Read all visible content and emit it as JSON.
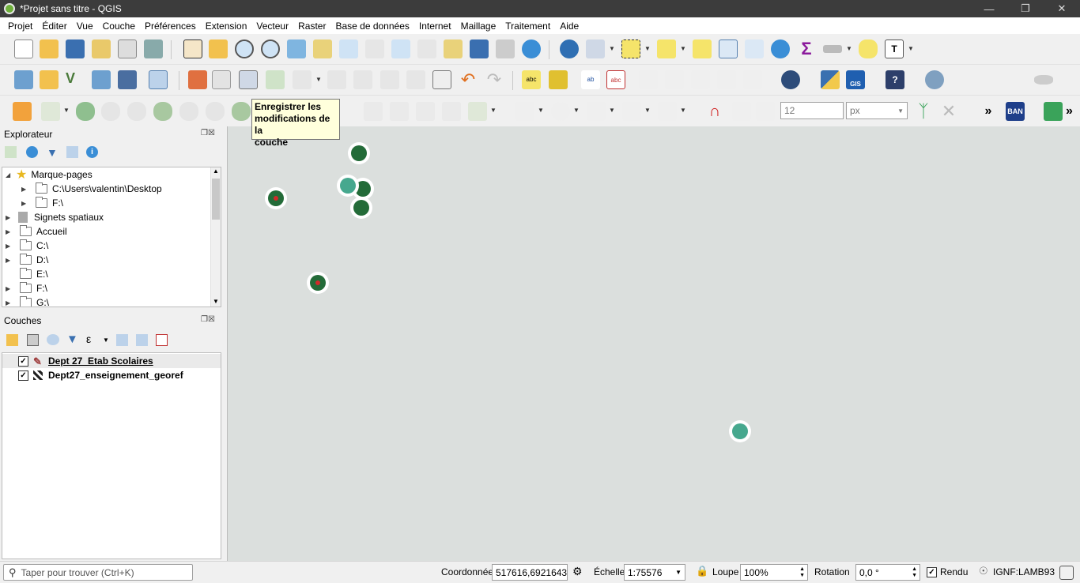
{
  "window": {
    "title": "*Projet sans titre - QGIS"
  },
  "menu": [
    "Projet",
    "Éditer",
    "Vue",
    "Couche",
    "Préférences",
    "Extension",
    "Vecteur",
    "Raster",
    "Base de données",
    "Internet",
    "Maillage",
    "Traitement",
    "Aide"
  ],
  "toolbar": {
    "snap_tolerance_value": "12",
    "snap_units": "px",
    "ban_label": "BAN",
    "gis_label": "GIS"
  },
  "tooltip": {
    "line1": "Enregistrer les",
    "line2": "modifications de la",
    "line3": "couche"
  },
  "explorer": {
    "title": "Explorateur",
    "items": [
      {
        "label": "Marque-pages"
      },
      {
        "label": "C:\\Users\\valentin\\Desktop"
      },
      {
        "label": "F:\\"
      },
      {
        "label": "Signets spatiaux"
      },
      {
        "label": "Accueil"
      },
      {
        "label": "C:\\"
      },
      {
        "label": "D:\\"
      },
      {
        "label": "E:\\"
      },
      {
        "label": "F:\\"
      },
      {
        "label": "G:\\"
      }
    ]
  },
  "layers": {
    "title": "Couches",
    "items": [
      {
        "label": "Dept 27_Etab Scolaires",
        "checked": true
      },
      {
        "label": "Dept27_enseignement_georef",
        "checked": true
      }
    ]
  },
  "status": {
    "search_placeholder": "Taper pour trouver (Ctrl+K)",
    "coord_label": "Coordonnée",
    "coord_value": "517616,6921643",
    "scale_label": "Échelle",
    "scale_value": "1:75576",
    "magnifier_label": "Loupe",
    "magnifier_value": "100%",
    "rotation_label": "Rotation",
    "rotation_value": "0,0 °",
    "render_label": "Rendu",
    "crs_label": "IGNF:LAMB93"
  },
  "colors": {
    "canvas": "#dbdfdd",
    "point_dark": "#236b38",
    "point_light": "#46a88e",
    "highlight": "#e02020"
  }
}
